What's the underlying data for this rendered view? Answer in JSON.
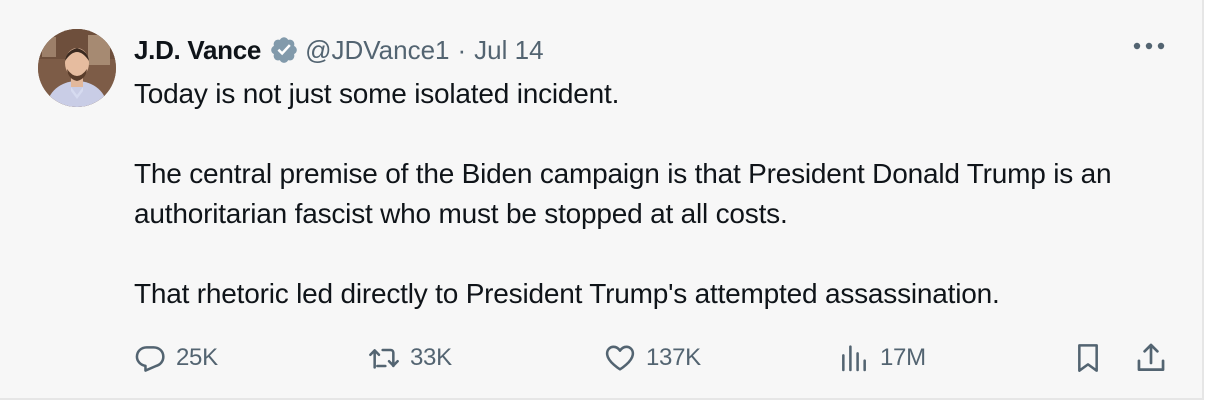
{
  "author": {
    "display_name": "J.D. Vance",
    "handle": "@JDVance1",
    "separator": "·",
    "timestamp": "Jul 14",
    "verified": true,
    "avatar_icon": "profile-photo"
  },
  "tweet": {
    "paragraphs": [
      "Today is not just some isolated incident.",
      "The central premise of the Biden campaign is that President Donald Trump is an authoritarian fascist who must be stopped at all costs.",
      "That rhetoric led directly to President Trump's attempted assassination."
    ]
  },
  "actions": {
    "replies": "25K",
    "reposts": "33K",
    "likes": "137K",
    "views": "17M"
  },
  "icons": {
    "verified": "verified-badge-icon",
    "more": "more-icon",
    "reply": "reply-icon",
    "repost": "repost-icon",
    "like": "heart-icon",
    "views": "bar-chart-icon",
    "bookmark": "bookmark-icon",
    "share": "share-icon"
  },
  "colors": {
    "background": "#f7f7f7",
    "text": "#0f1419",
    "secondary": "#536471",
    "verified_badge": "#829aab"
  }
}
